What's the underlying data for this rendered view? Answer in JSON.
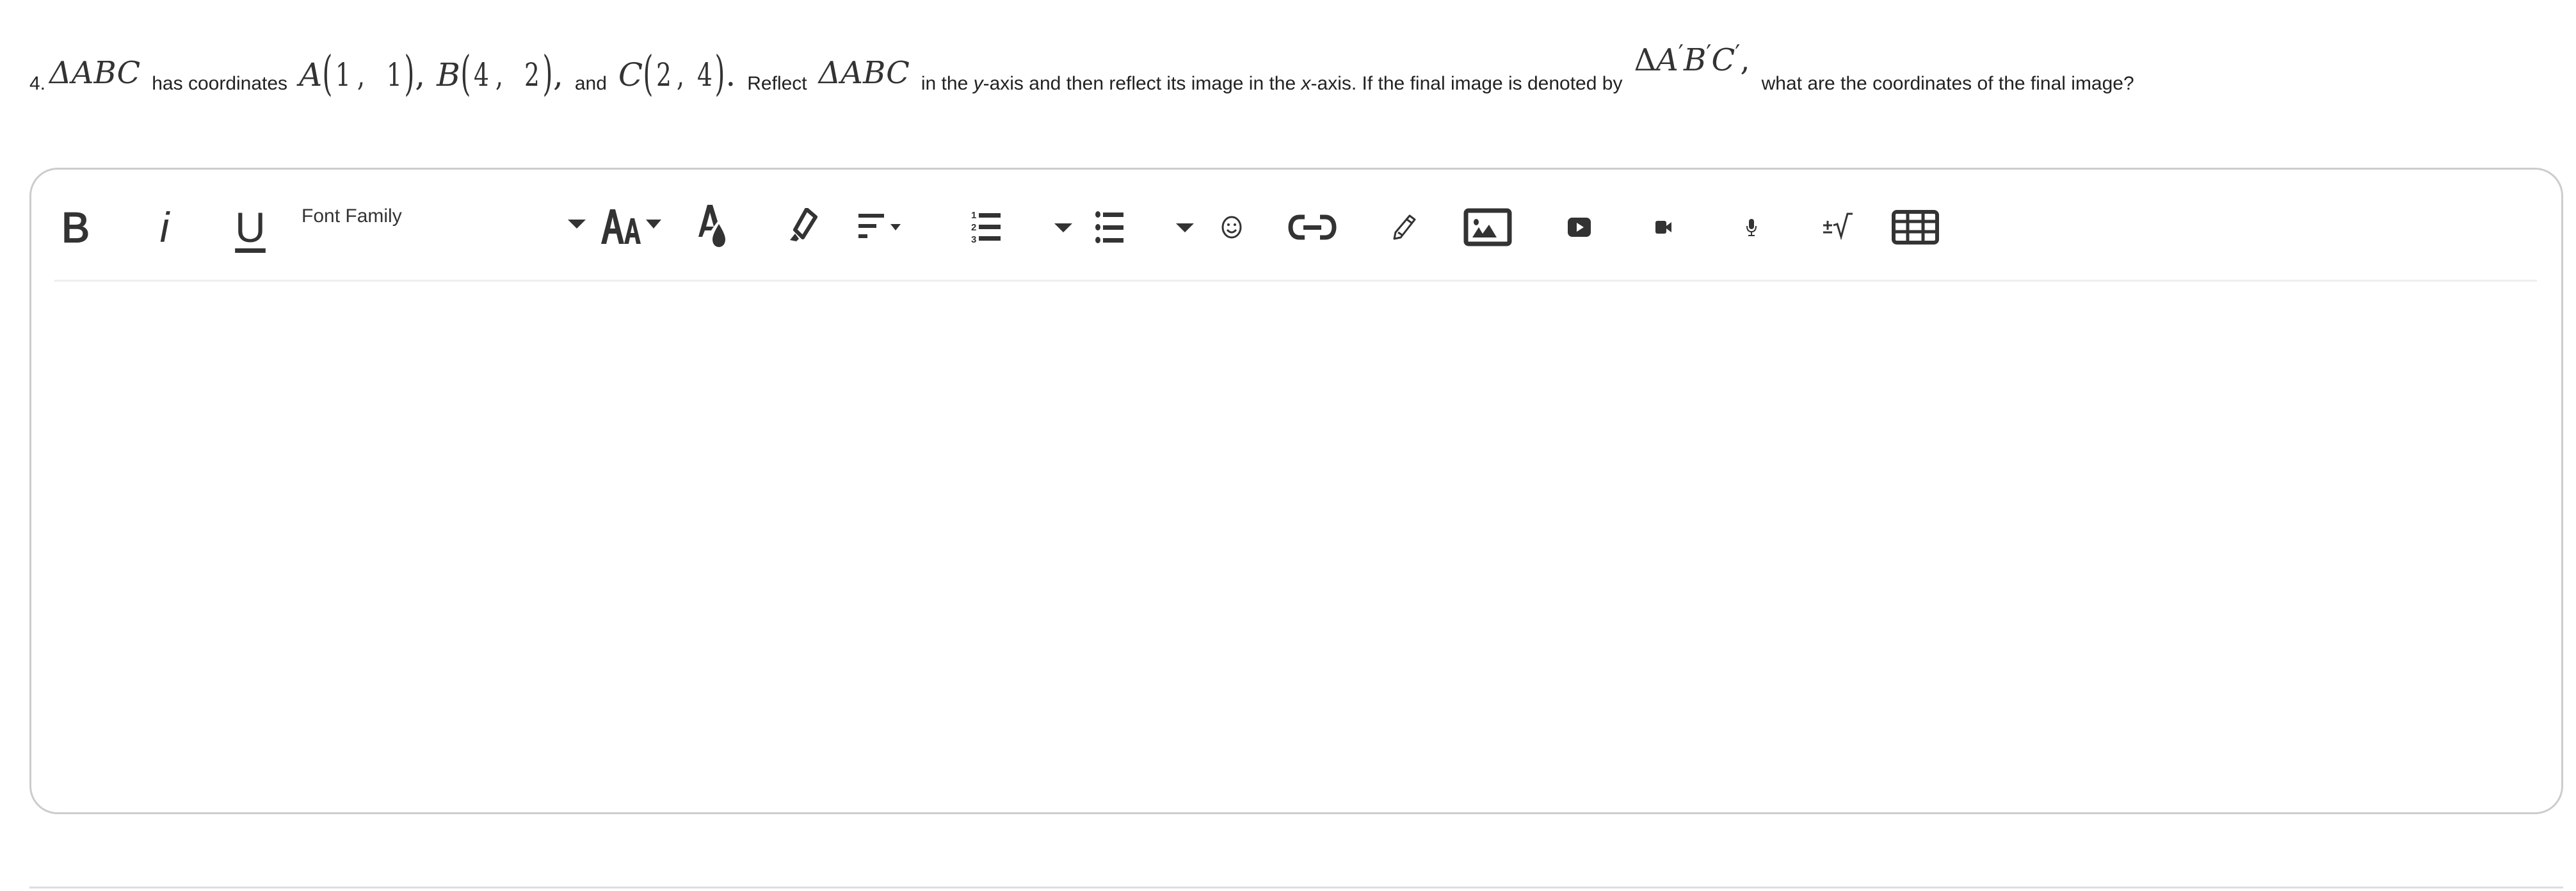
{
  "question": {
    "number": "4.",
    "triangle": "ΔABC",
    "text_has_coordinates": "has coordinates",
    "points": [
      {
        "label": "A",
        "x": "1",
        "y": "1",
        "suffix": ","
      },
      {
        "label": "B",
        "x": "4",
        "y": "2",
        "suffix": ","
      },
      {
        "label": "C",
        "x": "2",
        "y": "4",
        "suffix": "."
      }
    ],
    "text_and": "and",
    "text_reflect": "Reflect",
    "triangle_again": "ΔABC",
    "text_middle_pre": "in the ",
    "text_y": "y",
    "text_middle_1": "-axis and then reflect its image in the ",
    "text_x": "x",
    "text_middle_2": "-axis. If the final image is denoted by",
    "image_triangle": {
      "delta": "Δ",
      "a": "A",
      "b": "B",
      "c": "C",
      "prime": "′",
      "suffix": ","
    },
    "text_end": "what are the coordinates of the final image?"
  },
  "editor": {
    "toolbar": {
      "bold": {
        "icon": "bold-icon",
        "glyph": "B"
      },
      "italic": {
        "icon": "italic-icon",
        "glyph": "i"
      },
      "underline": {
        "icon": "underline-icon",
        "glyph": "U"
      },
      "font_family": {
        "label": "Font Family"
      },
      "font_size": {
        "icon": "font-size-icon"
      },
      "font_color": {
        "icon": "font-color-icon"
      },
      "highlight": {
        "icon": "highlighter-icon"
      },
      "align": {
        "icon": "align-left-icon"
      },
      "ordered_list": {
        "icon": "ordered-list-icon"
      },
      "unordered_list": {
        "icon": "bullet-list-icon"
      },
      "emoji": {
        "icon": "emoji-icon"
      },
      "link": {
        "icon": "link-icon"
      },
      "draw": {
        "icon": "pencil-icon"
      },
      "image": {
        "icon": "image-icon"
      },
      "video_embed": {
        "icon": "youtube-play-icon"
      },
      "video_record": {
        "icon": "video-camera-icon"
      },
      "audio": {
        "icon": "microphone-icon"
      },
      "math": {
        "icon": "math-equation-icon",
        "glyph": "±√"
      },
      "table": {
        "icon": "table-icon"
      }
    },
    "body_value": ""
  }
}
